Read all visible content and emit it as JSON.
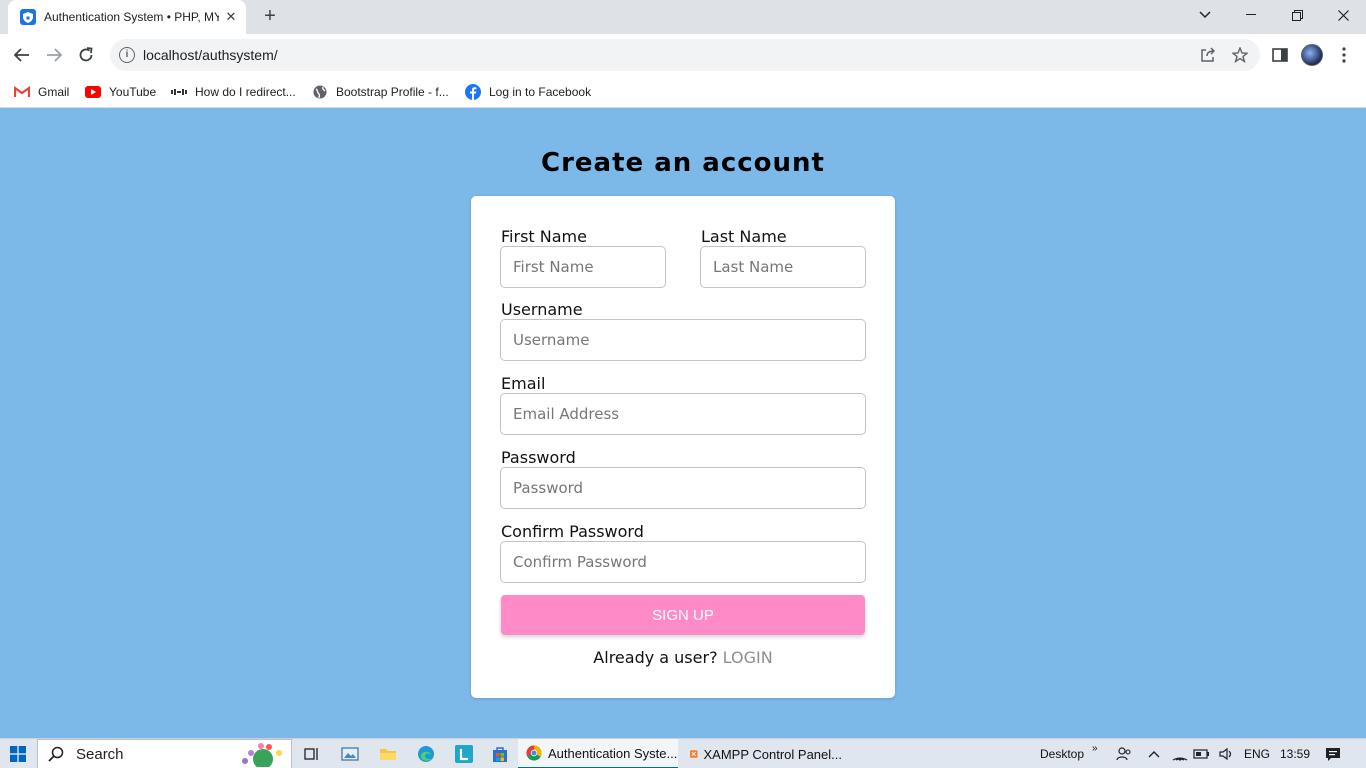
{
  "browser": {
    "tab_title": "Authentication System • PHP, MY",
    "tab_close": "✕",
    "new_tab": "+",
    "url": "localhost/authsystem/",
    "bookmarks": [
      "Gmail",
      "YouTube",
      "How do I redirect...",
      "Bootstrap Profile - f...",
      "Log in to Facebook"
    ]
  },
  "page": {
    "heading": "Create an account",
    "fields": {
      "first_name": {
        "label": "First Name",
        "placeholder": "First Name"
      },
      "last_name": {
        "label": "Last Name",
        "placeholder": "Last Name"
      },
      "username": {
        "label": "Username",
        "placeholder": "Username"
      },
      "email": {
        "label": "Email",
        "placeholder": "Email Address"
      },
      "password": {
        "label": "Password",
        "placeholder": "Password"
      },
      "confirm_password": {
        "label": "Confirm Password",
        "placeholder": "Confirm Password"
      }
    },
    "signup_label": "SIGN UP",
    "already_text": "Already a user?",
    "login_label": "LOGIN"
  },
  "taskbar": {
    "search_label": "Search",
    "apps": [
      "Authentication Syste...",
      "XAMPP Control Panel..."
    ],
    "desktop_label": "Desktop",
    "language": "ENG",
    "time": "13:59"
  },
  "colors": {
    "page_bg": "#7cb8e8",
    "signup_bg": "#ff8ac8",
    "login_link": "#8a8f94"
  }
}
